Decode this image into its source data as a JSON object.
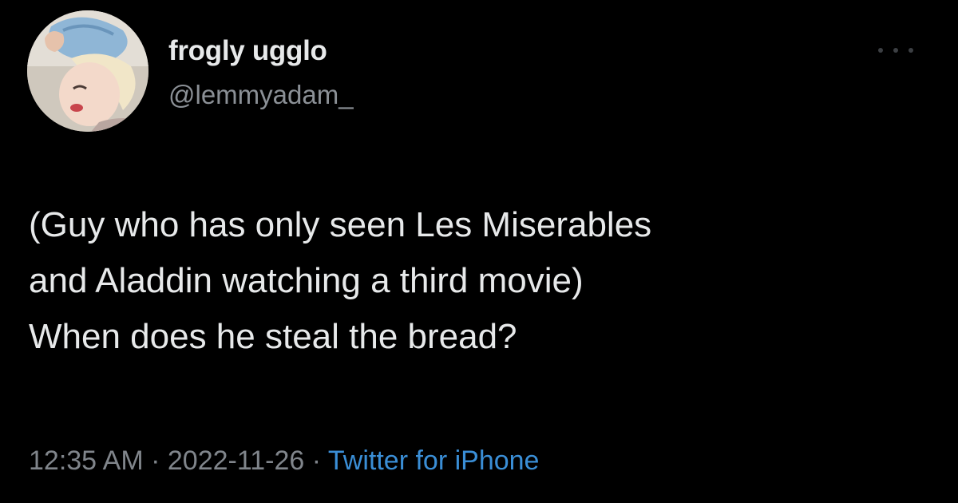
{
  "author": {
    "display_name": "frogly ugglo",
    "handle": "@lemmyadam_"
  },
  "tweet": {
    "lines": [
      "(Guy who has only seen Les Miserables",
      "and Aladdin watching a third movie)",
      "When does he steal the bread?"
    ]
  },
  "meta": {
    "time": "12:35 AM",
    "separator": "·",
    "date": "2022-11-26",
    "source": "Twitter for iPhone"
  },
  "icons": {
    "more": "more-horizontal-icon",
    "avatar": "profile-avatar"
  },
  "colors": {
    "background": "#000000",
    "text": "#e7e9ea",
    "secondary": "#80858b",
    "link": "#3a8ed6"
  }
}
